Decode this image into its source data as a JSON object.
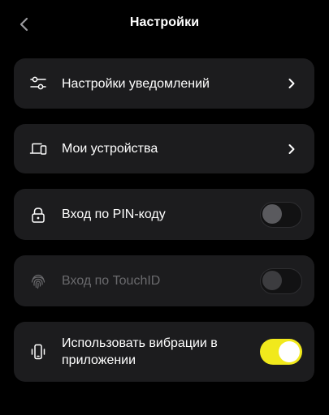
{
  "header": {
    "title": "Настройки"
  },
  "items": [
    {
      "label": "Настройки уведомлений",
      "icon": "sliders-icon",
      "control": "chevron"
    },
    {
      "label": "Мои устройства",
      "icon": "devices-icon",
      "control": "chevron"
    },
    {
      "label": "Вход по PIN-коду",
      "icon": "lock-icon",
      "control": "toggle",
      "on": false
    },
    {
      "label": "Вход по TouchID",
      "icon": "fingerprint-icon",
      "control": "toggle",
      "on": false,
      "disabled": true
    },
    {
      "label": "Использовать вибрации в приложении",
      "icon": "vibration-icon",
      "control": "toggle",
      "on": true
    }
  ],
  "colors": {
    "background": "#000000",
    "card": "#1c1c1e",
    "accent": "#f1e91c",
    "disabled_text": "#6a6a6d"
  }
}
